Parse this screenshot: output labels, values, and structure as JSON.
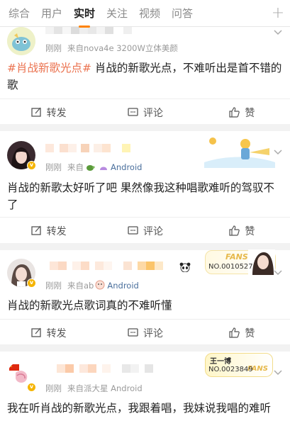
{
  "tabs": [
    {
      "label": "综合"
    },
    {
      "label": "用户"
    },
    {
      "label": "实时"
    },
    {
      "label": "关注"
    },
    {
      "label": "视频"
    },
    {
      "label": "问答"
    }
  ],
  "add_icon": "plus-icon",
  "posts": [
    {
      "time": "刚刚",
      "source": "来自nova4e 3200W立体美颜",
      "tag": "#肖战新歌光点#",
      "text": " 肖战的新歌光点，不难听出是首不错的歌",
      "actions": {
        "repost": "转发",
        "comment": "评论",
        "like": "赞"
      }
    },
    {
      "time": "刚刚",
      "source_prefix": "来自",
      "source": "Android",
      "text": "肖战的新歌太好听了吧 果然像我这种唱歌难听的驾驭不了",
      "actions": {
        "repost": "转发",
        "comment": "评论",
        "like": "赞"
      }
    },
    {
      "time": "刚刚",
      "source_prefix": "来自ab",
      "source": "Android",
      "fans_label": "FANS",
      "fans_no": "NO.0010527",
      "text": "肖战的新歌光点歌词真的不难听懂",
      "actions": {
        "repost": "转发",
        "comment": "评论",
        "like": "赞"
      }
    },
    {
      "time": "刚刚",
      "source": "来自派大星 Android",
      "fans_name": "王一博",
      "fans_label": "FANS",
      "fans_no": "NO.0023849",
      "text": "我在听肖战的新歌光点，我跟着唱，我妹说我唱的难听",
      "actions": {
        "repost": "转发",
        "comment": "评论",
        "like": "赞"
      }
    }
  ],
  "colors": {
    "accent": "#ff8200",
    "tag": "#eb7350",
    "meta": "#9a9a9a",
    "vip": "#f5b400"
  }
}
